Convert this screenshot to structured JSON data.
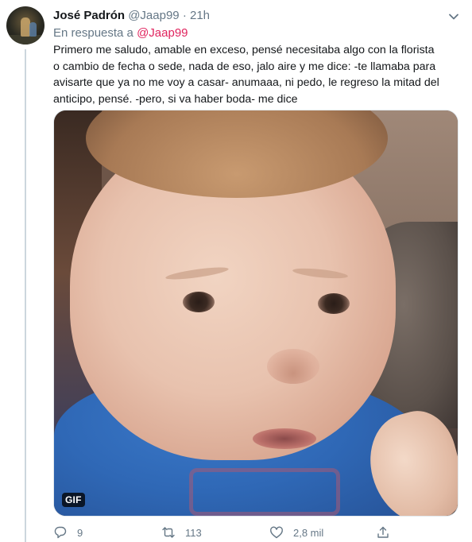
{
  "tweet": {
    "author_name": "José Padrón",
    "handle": "@Jaap99",
    "separator": "·",
    "time": "21h",
    "reply_label": "En respuesta a",
    "reply_mention": "@Jaap99",
    "text_lines": [
      "Primero me saludo, amable en exceso, pensé necesitaba algo con la florista",
      "o cambio de fecha o sede, nada de eso, jalo aire y me dice: -te llamaba para",
      "avisarte que ya no me voy a casar- anumaaa, ni pedo, le regreso la mitad del",
      "anticipo, pensé. -pero, si va haber boda- me dice"
    ],
    "media": {
      "badge": "GIF"
    },
    "actions": {
      "replies": "9",
      "retweets": "113",
      "likes": "2,8 mil"
    },
    "icons": {
      "more": "chevron-down-icon",
      "reply": "reply-icon",
      "retweet": "retweet-icon",
      "like": "heart-icon",
      "share": "share-icon"
    },
    "colors": {
      "mention": "#e0245e",
      "secondary_text": "#657786",
      "primary_text": "#14171a",
      "thread_line": "#ccd6dd"
    }
  }
}
